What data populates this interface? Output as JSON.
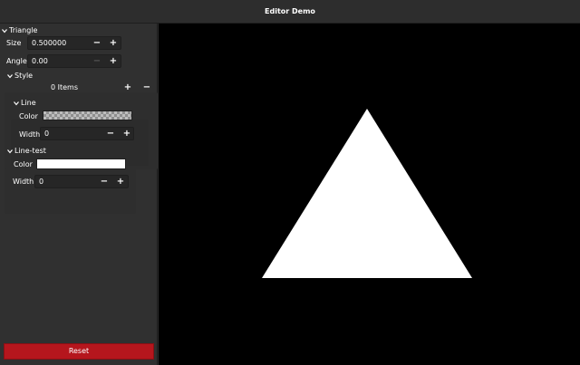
{
  "window": {
    "title": "Editor Demo"
  },
  "panel": {
    "triangle_header": "Triangle",
    "size": {
      "label": "Size",
      "value": "0.500000"
    },
    "angle": {
      "label": "Angle",
      "value": "0.00"
    },
    "style": {
      "header": "Style",
      "items_count": "0 Items",
      "line": {
        "header": "Line",
        "color_label": "Color",
        "width_label": "Width",
        "width_value": "0"
      }
    },
    "line_test": {
      "header": "Line-test",
      "color_label": "Color",
      "color": "#ffffff",
      "width_label": "Width",
      "width_value": "0"
    },
    "minus_symbol": "−",
    "plus_symbol": "+",
    "reset_label": "Reset"
  },
  "viewport": {
    "background": "#000000",
    "shape": "triangle",
    "fill": "#ffffff"
  },
  "colors": {
    "accent": "#b5161d",
    "panel": "#303030"
  }
}
